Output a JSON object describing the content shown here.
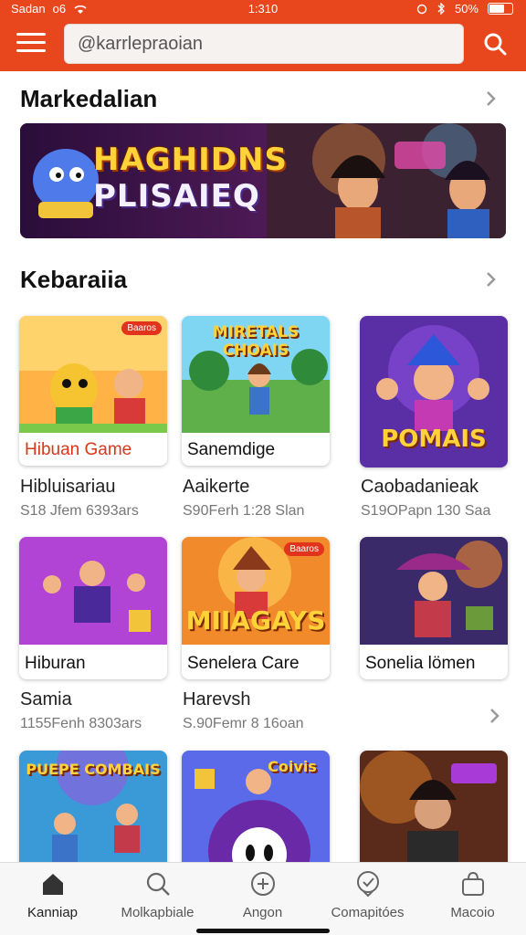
{
  "status_bar": {
    "carrier": "Sadan",
    "network": "o6",
    "time": "1:310",
    "battery": "50%"
  },
  "header": {
    "search_value": "@karrlepraoian"
  },
  "sections": [
    {
      "title": "Markedalian"
    },
    {
      "title": "Kebaraiia"
    }
  ],
  "banner": {
    "line1": "HAGHIDNS",
    "line2": "PLISAIEQ"
  },
  "cards": [
    {
      "caption": "Hibuan Game",
      "badge": "Baaros",
      "art_text": "",
      "title": "Hibluisariau",
      "subtitle": "S18 Jfem 6393ars"
    },
    {
      "caption": "Sanemdige",
      "badge": "",
      "art_text": "MIRETALS CHOAIS",
      "title": "Aaikerte",
      "subtitle": "S90Ferh 1:28 Slan"
    },
    {
      "caption": "",
      "badge": "",
      "art_text": "POMAIS",
      "title": "Caobadanieak",
      "subtitle": "S19OPapn 130 Saa"
    },
    {
      "caption": "Hiburan",
      "badge": "",
      "art_text": "",
      "title": "Samia",
      "subtitle": "1155Fenh 8303ars"
    },
    {
      "caption": "Senelera Care",
      "badge": "Baaros",
      "art_text": "MIIAGAYS",
      "title": "Harevsh",
      "subtitle": "S.90Femr 8 16oan"
    },
    {
      "caption": "Sonelia lömen",
      "badge": "",
      "art_text": "",
      "title": "",
      "subtitle": ""
    },
    {
      "caption": "",
      "badge": "",
      "art_text": "PUEPE COMBAIS",
      "title": "",
      "subtitle": ""
    },
    {
      "caption": "",
      "badge": "",
      "art_text": "Coivis",
      "title": "",
      "subtitle": ""
    },
    {
      "caption": "",
      "badge": "",
      "art_text": "",
      "title": "",
      "subtitle": ""
    }
  ],
  "bottom_nav": [
    {
      "label": "Kanniap",
      "icon": "home-icon",
      "active": true
    },
    {
      "label": "Molkapbiale",
      "icon": "search-icon",
      "active": false
    },
    {
      "label": "Angon",
      "icon": "add-circle-icon",
      "active": false
    },
    {
      "label": "Comapitóes",
      "icon": "check-badge-icon",
      "active": false
    },
    {
      "label": "Macoio",
      "icon": "bag-icon",
      "active": false
    }
  ],
  "colors": {
    "brand": "#e8461c",
    "accent_text": "#d9361a"
  }
}
